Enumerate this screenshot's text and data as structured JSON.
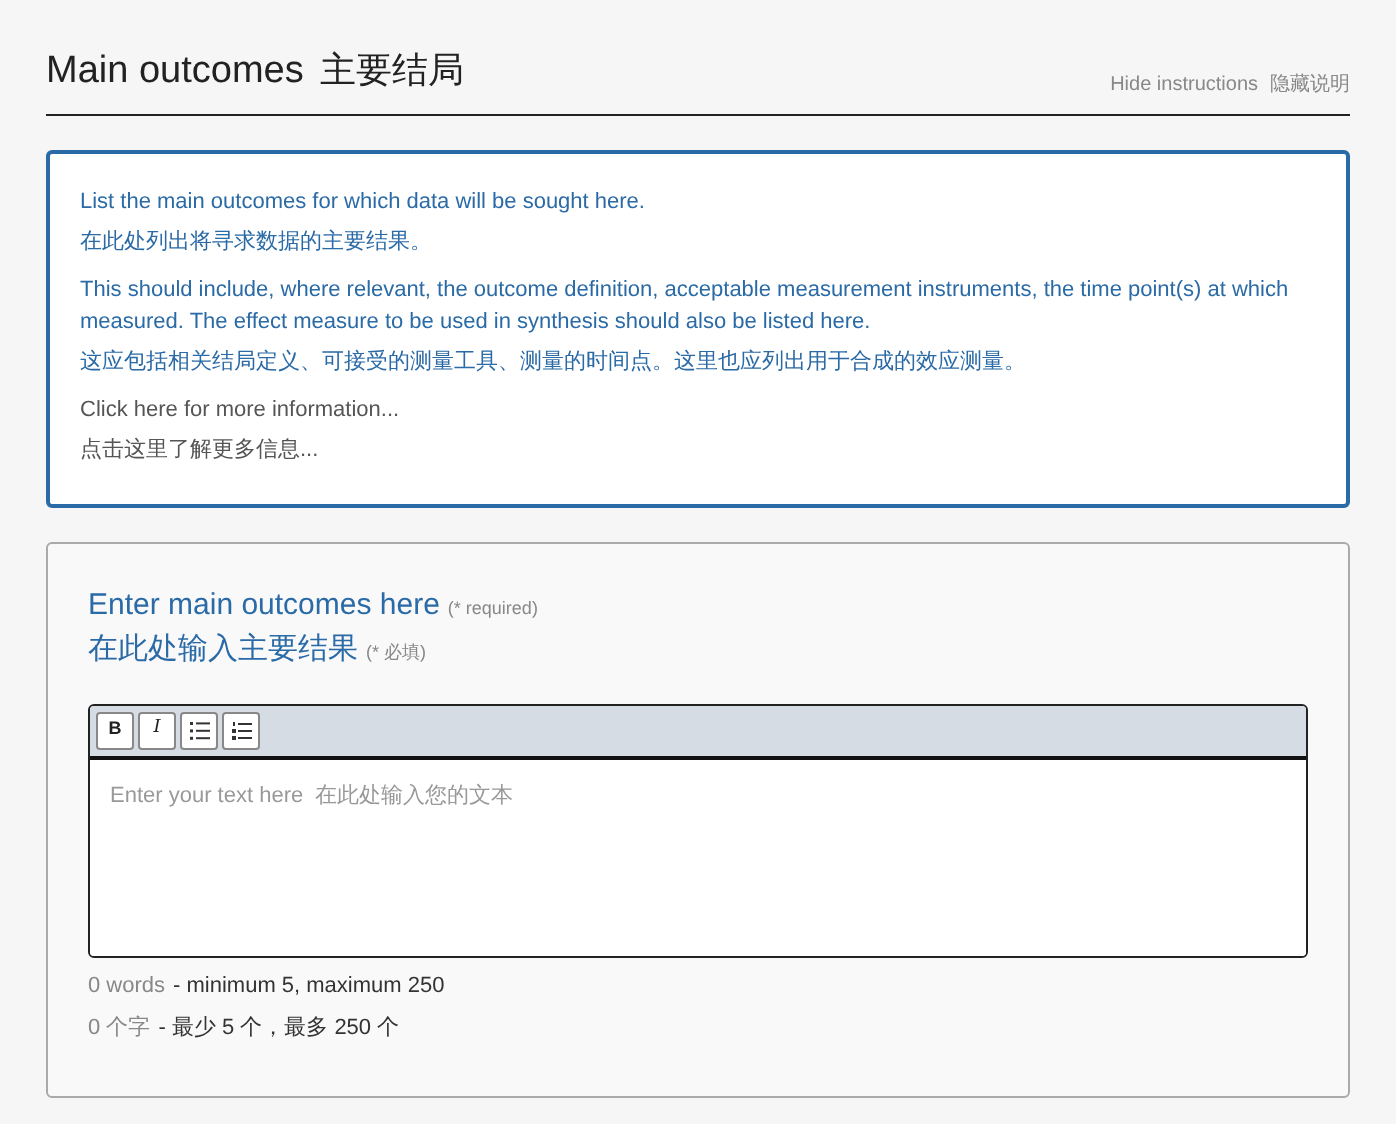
{
  "header": {
    "title": "Main outcomes",
    "title_zh": "主要结局",
    "hide_link": "Hide instructions",
    "hide_link_zh": "隐藏说明"
  },
  "instructions": [
    {
      "kind": "text",
      "text": "List the main outcomes for which data will be sought here."
    },
    {
      "kind": "text",
      "text": "在此处列出将寻求数据的主要结果。"
    },
    {
      "kind": "text",
      "text": "This should include, where relevant, the outcome definition, acceptable measurement instruments, the time point(s) at which measured. The effect measure to be used in synthesis should also be listed here."
    },
    {
      "kind": "text",
      "text": "这应包括相关结局定义、可接受的测量工具、测量的时间点。这里也应列出用于合成的效应测量。"
    },
    {
      "kind": "link",
      "text": "Click here for more information..."
    },
    {
      "kind": "link",
      "text": "点击这里了解更多信息..."
    }
  ],
  "form": {
    "label": "Enter main outcomes here",
    "required": "(* required)",
    "label_zh": "在此处输入主要结果",
    "required_zh": "(* 必填)",
    "toolbar": [
      {
        "kind": "bold",
        "label": "B"
      },
      {
        "kind": "italic",
        "label": "I"
      },
      {
        "kind": "bullets"
      },
      {
        "kind": "numbered"
      }
    ],
    "placeholder": "Enter your text here  在此处输入您的文本",
    "count": "0 words",
    "limits": "- minimum 5, maximum 250",
    "count_zh": "0 个字",
    "limits_zh": "- 最少 5 个，最多 250 个"
  }
}
